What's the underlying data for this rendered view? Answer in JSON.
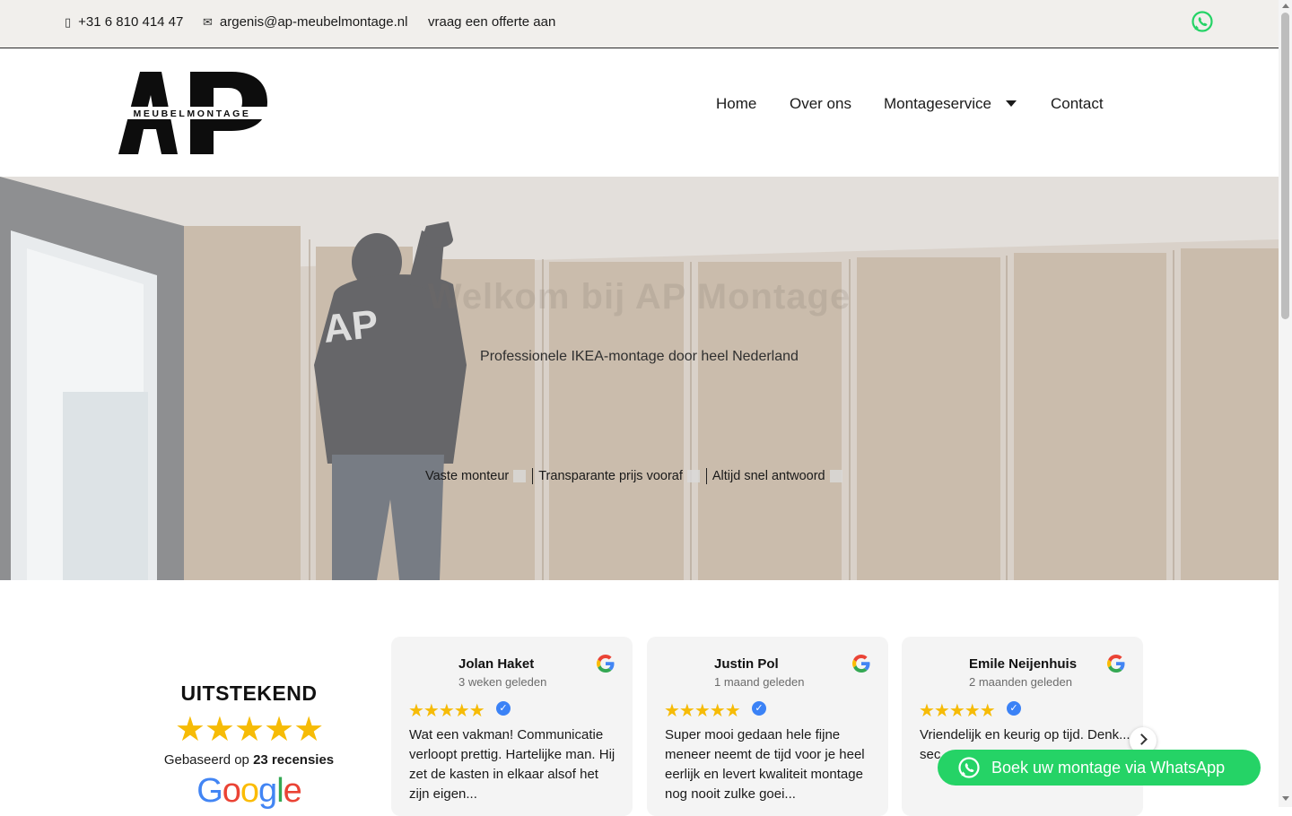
{
  "topbar": {
    "phone": "+31 6 810 414 47",
    "phone_icon": "phone-icon",
    "email": "argenis@ap-meubelmontage.nl",
    "email_icon": "envelope-icon",
    "quote_link": "vraag een offerte aan",
    "whatsapp_icon": "whatsapp-icon"
  },
  "brand": {
    "logo_letters": "AP",
    "logo_wordmark": "MEUBELMONTAGE"
  },
  "nav": {
    "items": [
      "Home",
      "Over ons",
      "Montageservice",
      "Contact"
    ],
    "dropdown_icon": "caret-down-icon"
  },
  "hero": {
    "title": "Welkom bij AP Montage",
    "subtitle": "Professionele IKEA-montage door heel Nederland",
    "usps": [
      "Vaste monteur",
      "Transparante prijs vooraf",
      "Altijd snel antwoord"
    ],
    "separator": "|"
  },
  "reviews": {
    "rating_label": "UITSTEKEND",
    "stars": "★★★★★",
    "based_prefix": "Gebaseerd op",
    "based_count": "23 recensies",
    "provider": "Google",
    "items": [
      {
        "name": "Jolan Haket",
        "when": "3 weken geleden",
        "stars": "★★★★★",
        "text": "Wat een vakman! Communicatie verloopt prettig. Hartelijke man. Hij zet de kasten in elkaar alsof het zijn eigen..."
      },
      {
        "name": "Justin Pol",
        "when": "1 maand geleden",
        "stars": "★★★★★",
        "text": "Super mooi gedaan hele fijne meneer neemt de tijd voor je heel eerlijk en levert kwaliteit montage nog nooit zulke goei..."
      },
      {
        "name": "Emile Neijenhuis",
        "when": "2 maanden geleden",
        "stars": "★★★★★",
        "text": "Vriendelijk en keurig op tijd. Denk... sec..."
      }
    ]
  },
  "cta": {
    "label": "Boek uw montage via WhatsApp"
  },
  "colors": {
    "topbar_bg": "#f1efec",
    "whatsapp_green": "#25d366",
    "star_gold": "#f6bb06",
    "verified_blue": "#3b82f6"
  }
}
